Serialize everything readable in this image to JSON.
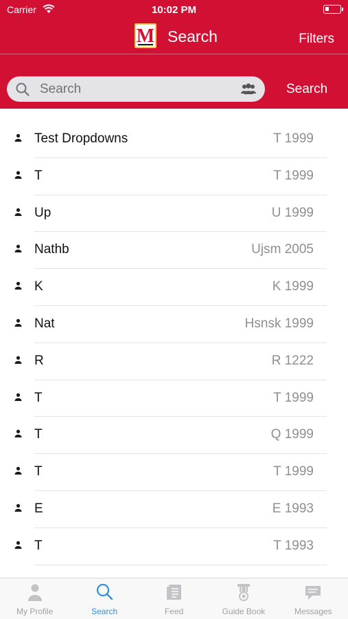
{
  "status_bar": {
    "carrier": "Carrier",
    "time": "10:02 PM"
  },
  "nav": {
    "title": "Search",
    "filters_label": "Filters",
    "logo_letter": "M"
  },
  "search": {
    "placeholder": "Search",
    "value": "",
    "button_label": "Search"
  },
  "results": [
    {
      "name": "Test Dropdowns",
      "meta": "T 1999"
    },
    {
      "name": "T",
      "meta": "T 1999"
    },
    {
      "name": "Up",
      "meta": "U 1999"
    },
    {
      "name": "Nathb",
      "meta": "Ujsm 2005"
    },
    {
      "name": "K",
      "meta": "K 1999"
    },
    {
      "name": "Nat",
      "meta": "Hsnsk 1999"
    },
    {
      "name": "R",
      "meta": "R 1222"
    },
    {
      "name": "T",
      "meta": "T 1999"
    },
    {
      "name": "T",
      "meta": "Q 1999"
    },
    {
      "name": "T",
      "meta": "T 1999"
    },
    {
      "name": "E",
      "meta": "E 1993"
    },
    {
      "name": "T",
      "meta": "T 1993"
    }
  ],
  "tabs": [
    {
      "label": "My Profile",
      "icon": "person-icon",
      "active": false
    },
    {
      "label": "Search",
      "icon": "search-icon",
      "active": true
    },
    {
      "label": "Feed",
      "icon": "feed-icon",
      "active": false
    },
    {
      "label": "Guide Book",
      "icon": "guide-book-icon",
      "active": false
    },
    {
      "label": "Messages",
      "icon": "messages-icon",
      "active": false
    }
  ],
  "colors": {
    "brand_red": "#d21034",
    "tab_active": "#2f8ee0",
    "tab_inactive": "#a0a0a5"
  }
}
